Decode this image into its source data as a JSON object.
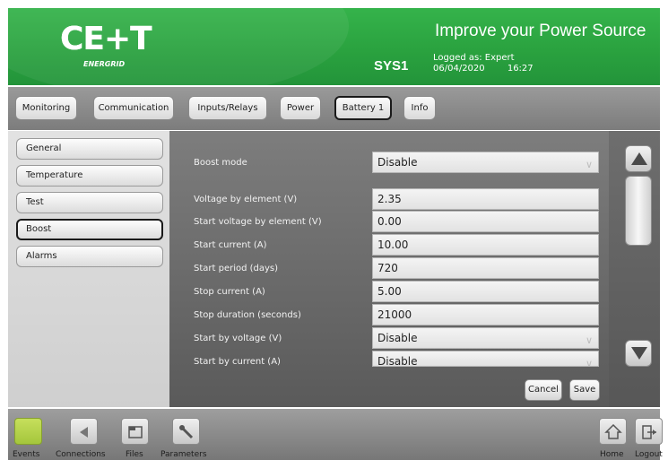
{
  "header": {
    "logo_text": "CE+T",
    "logo_sub": "ENERGRID",
    "system_name": "SYS1",
    "slogan": "Improve your Power Source",
    "logged_as": "Logged as: Expert",
    "date": "06/04/2020",
    "time": "16:27",
    "accent_color": "#2aa23f"
  },
  "tabs": [
    {
      "label": "Monitoring"
    },
    {
      "label": "Communication"
    },
    {
      "label": "Inputs/Relays"
    },
    {
      "label": "Power"
    },
    {
      "label": "Battery 1",
      "active": true
    },
    {
      "label": "Info"
    }
  ],
  "sidebar": {
    "items": [
      {
        "label": "General"
      },
      {
        "label": "Temperature"
      },
      {
        "label": "Test"
      },
      {
        "label": "Boost",
        "active": true
      },
      {
        "label": "Alarms"
      }
    ]
  },
  "form": {
    "fields": [
      {
        "label": "Boost mode",
        "value": "Disable",
        "type": "select"
      },
      {
        "label": "Voltage by element (V)",
        "value": "2.35"
      },
      {
        "label": "Start voltage by element (V)",
        "value": "0.00"
      },
      {
        "label": "Start current (A)",
        "value": "10.00"
      },
      {
        "label": "Start period (days)",
        "value": "720"
      },
      {
        "label": "Stop current (A)",
        "value": "5.00"
      },
      {
        "label": "Stop duration (seconds)",
        "value": "21000"
      },
      {
        "label": "Start by voltage (V)",
        "value": "Disable",
        "type": "select"
      },
      {
        "label": "Start by current (A)",
        "value": "Disable",
        "type": "select"
      }
    ],
    "cancel_label": "Cancel",
    "save_label": "Save"
  },
  "scroll": {
    "up_icon": "triangle-up-icon",
    "down_icon": "triangle-down-icon"
  },
  "footer": {
    "events_label": "Events",
    "connections_label": "Connections",
    "files_label": "Files",
    "parameters_label": "Parameters",
    "home_label": "Home",
    "logout_label": "Logout",
    "events_color": "#b5d34a"
  }
}
